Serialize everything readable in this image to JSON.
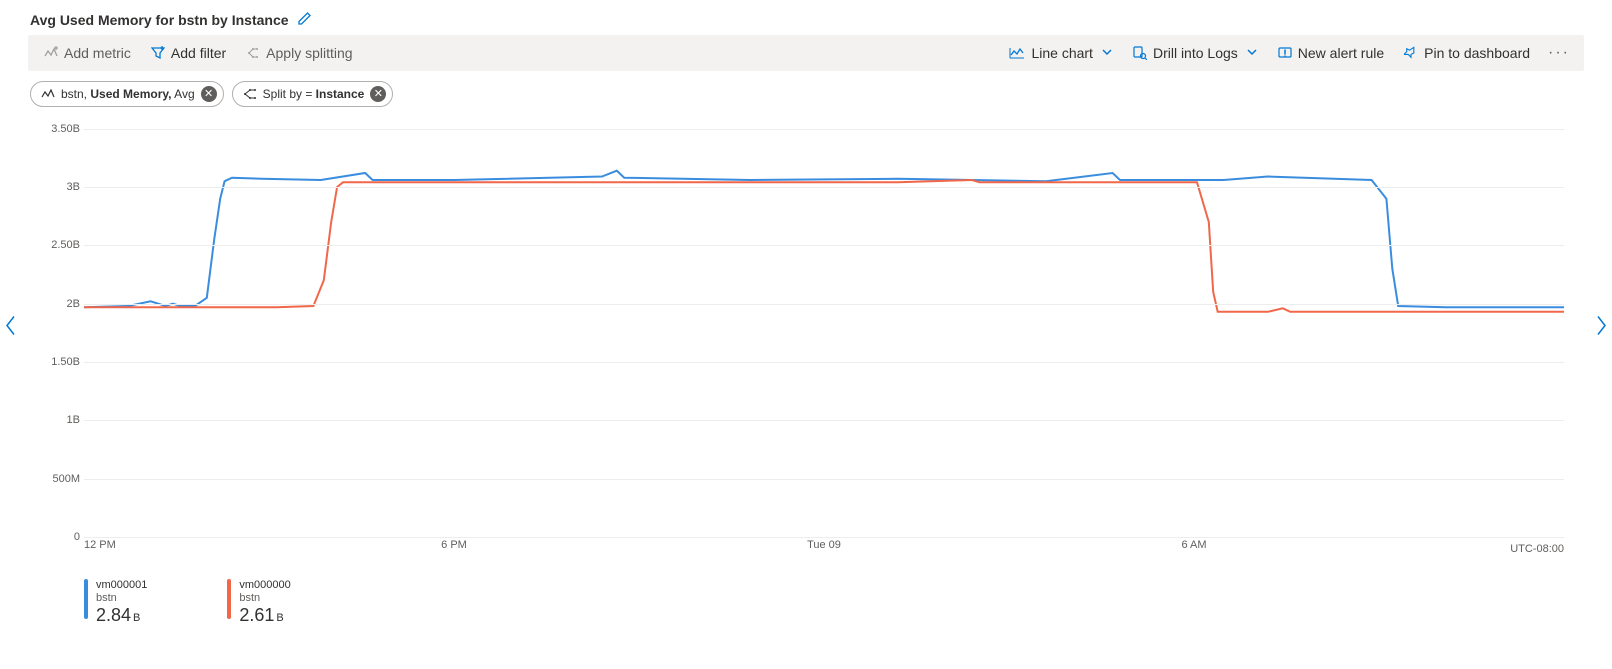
{
  "title": "Avg Used Memory for bstn by Instance",
  "toolbar": {
    "add_metric": "Add metric",
    "add_filter": "Add filter",
    "apply_splitting": "Apply splitting",
    "line_chart": "Line chart",
    "drill_logs": "Drill into Logs",
    "new_alert": "New alert rule",
    "pin": "Pin to dashboard"
  },
  "chips": {
    "metric_prefix": "bstn, ",
    "metric_bold": "Used Memory,",
    "metric_suffix": " Avg",
    "split_prefix": "Split by = ",
    "split_bold": "Instance"
  },
  "timezone": "UTC-08:00",
  "legend": [
    {
      "name": "vm000001",
      "sub": "bstn",
      "value": "2.84",
      "unit": "B",
      "color": "blue"
    },
    {
      "name": "vm000000",
      "sub": "bstn",
      "value": "2.61",
      "unit": "B",
      "color": "red"
    }
  ],
  "chart_data": {
    "type": "line",
    "title": "Avg Used Memory for bstn by Instance",
    "xlabel": "",
    "ylabel": "",
    "ylim": [
      0,
      3600000000
    ],
    "y_ticks": [
      {
        "value": 0,
        "label": "0"
      },
      {
        "value": 500000000,
        "label": "500M"
      },
      {
        "value": 1000000000,
        "label": "1B"
      },
      {
        "value": 1500000000,
        "label": "1.50B"
      },
      {
        "value": 2000000000,
        "label": "2B"
      },
      {
        "value": 2500000000,
        "label": "2.50B"
      },
      {
        "value": 3000000000,
        "label": "3B"
      },
      {
        "value": 3500000000,
        "label": "3.50B"
      }
    ],
    "x_ticks": [
      {
        "pos": 0.0,
        "label": "12 PM"
      },
      {
        "pos": 0.25,
        "label": "6 PM"
      },
      {
        "pos": 0.5,
        "label": "Tue 09"
      },
      {
        "pos": 0.75,
        "label": "6 AM"
      }
    ],
    "series": [
      {
        "name": "vm000001",
        "color": "blue",
        "points": [
          [
            0.0,
            1.97
          ],
          [
            0.03,
            1.98
          ],
          [
            0.045,
            2.02
          ],
          [
            0.055,
            1.98
          ],
          [
            0.06,
            2.0
          ],
          [
            0.065,
            1.98
          ],
          [
            0.075,
            1.98
          ],
          [
            0.083,
            2.05
          ],
          [
            0.088,
            2.55
          ],
          [
            0.092,
            2.9
          ],
          [
            0.095,
            3.05
          ],
          [
            0.1,
            3.08
          ],
          [
            0.12,
            3.07
          ],
          [
            0.16,
            3.06
          ],
          [
            0.19,
            3.12
          ],
          [
            0.195,
            3.06
          ],
          [
            0.25,
            3.06
          ],
          [
            0.35,
            3.09
          ],
          [
            0.36,
            3.14
          ],
          [
            0.365,
            3.08
          ],
          [
            0.45,
            3.06
          ],
          [
            0.55,
            3.07
          ],
          [
            0.65,
            3.05
          ],
          [
            0.695,
            3.12
          ],
          [
            0.7,
            3.06
          ],
          [
            0.77,
            3.06
          ],
          [
            0.8,
            3.09
          ],
          [
            0.87,
            3.06
          ],
          [
            0.88,
            2.9
          ],
          [
            0.884,
            2.3
          ],
          [
            0.888,
            1.98
          ],
          [
            0.92,
            1.97
          ],
          [
            1.0,
            1.97
          ]
        ]
      },
      {
        "name": "vm000000",
        "color": "red",
        "points": [
          [
            0.0,
            1.97
          ],
          [
            0.09,
            1.97
          ],
          [
            0.11,
            1.97
          ],
          [
            0.13,
            1.97
          ],
          [
            0.155,
            1.98
          ],
          [
            0.162,
            2.2
          ],
          [
            0.167,
            2.7
          ],
          [
            0.171,
            3.0
          ],
          [
            0.175,
            3.04
          ],
          [
            0.25,
            3.04
          ],
          [
            0.35,
            3.04
          ],
          [
            0.45,
            3.04
          ],
          [
            0.55,
            3.04
          ],
          [
            0.6,
            3.06
          ],
          [
            0.605,
            3.04
          ],
          [
            0.68,
            3.04
          ],
          [
            0.752,
            3.04
          ],
          [
            0.76,
            2.7
          ],
          [
            0.763,
            2.1
          ],
          [
            0.766,
            1.93
          ],
          [
            0.8,
            1.93
          ],
          [
            0.81,
            1.96
          ],
          [
            0.815,
            1.93
          ],
          [
            0.9,
            1.93
          ],
          [
            1.0,
            1.93
          ]
        ]
      }
    ]
  }
}
